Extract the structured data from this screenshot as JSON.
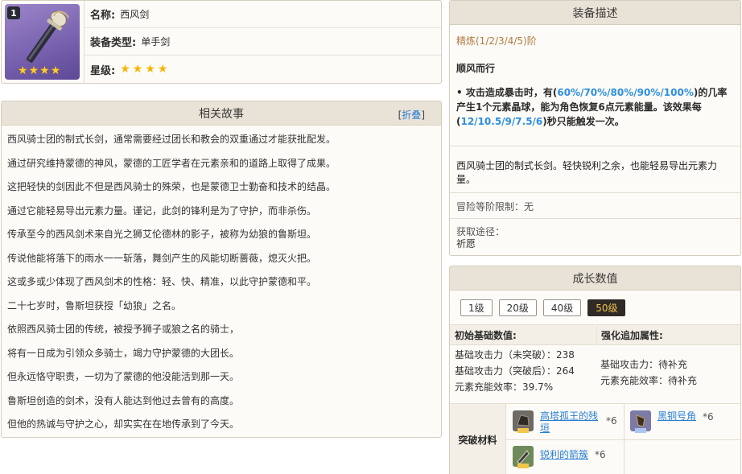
{
  "item": {
    "level": "1",
    "name_label": "名称:",
    "name": "西风剑",
    "type_label": "装备类型:",
    "type": "单手剑",
    "rarity_label": "星级:",
    "rarity_stars": 4
  },
  "story": {
    "title": "相关故事",
    "collapse_open": "[",
    "collapse_link": "折叠",
    "collapse_close": "]",
    "lines": [
      "西风骑士团的制式长剑，通常需要经过团长和教会的双重通过才能获批配发。",
      "通过研究维持蒙德的神风，蒙德的工匠学者在元素亲和的道路上取得了成果。",
      "这把轻快的剑因此不但是西风骑士的殊荣，也是蒙德卫士勤奋和技术的结晶。",
      "通过它能轻易导出元素力量。谨记，此剑的锋利是为了守护，而非杀伤。",
      "传承至今的西风剑术来自光之狮艾伦德林的影子，被称为幼狼的鲁斯坦。",
      "传说他能将落下的雨水一一斩落，舞剑产生的风能切断蔷薇，熄灭火把。",
      "这或多或少体现了西风剑术的性格：轻、快、精准，以此守护蒙德和平。",
      "二十七岁时，鲁斯坦获授「幼狼」之名。",
      "依照西风骑士团的传统，被授予狮子或狼之名的骑士，",
      "将有一日成为引领众多骑士，竭力守护蒙德的大团长。",
      "但永远恪守职责，一切为了蒙德的他没能活到那一天。",
      "鲁斯坦创造的剑术，没有人能达到他过去曾有的高度。",
      "但他的热诚与守护之心，却实实在在地传承到了今天。"
    ]
  },
  "desc": {
    "title": "装备描述",
    "refine": "精炼(1/2/3/4/5)阶",
    "skill_name": "顺风而行",
    "skill_p1": "• 攻击造成暴击时，有(",
    "skill_h1": "60%/70%/80%/90%/100%",
    "skill_p2": ")的几率产生1个元素晶球，能为角色恢复6点元素能量。该效果每(",
    "skill_h2": "12/10.5/9/7.5/6",
    "skill_p3": ")秒只能触发一次。",
    "weapon_desc": "西风骑士团的制式长剑。轻快锐利之余，也能轻易导出元素力量。",
    "limit": "冒险等阶限制：无",
    "obtain_label": "获取途径：",
    "obtain_value": "祈愿"
  },
  "growth": {
    "title": "成长数值",
    "levels": [
      "1级",
      "20级",
      "40级",
      "50级"
    ],
    "active_level": "50级",
    "base_head": "初始基础数值:",
    "bonus_head": "强化追加属性:",
    "base_stats": [
      "基础攻击力（未突破）：238",
      "基础攻击力（突破后）：264",
      "元素充能效率：39.7%"
    ],
    "bonus_stats": [
      "基础攻击力：待补充",
      "元素充能效率：待补充"
    ],
    "materials_label": "突破材料",
    "materials": [
      {
        "name": "高塔孤王的残垣",
        "qty": "*6",
        "icon": "tower-fragment-icon"
      },
      {
        "name": "黑铜号角",
        "qty": "*6",
        "icon": "black-bronze-horn-icon"
      },
      {
        "name": "锐利的箭簇",
        "qty": "*6",
        "icon": "sharp-arrowhead-icon"
      }
    ]
  }
}
